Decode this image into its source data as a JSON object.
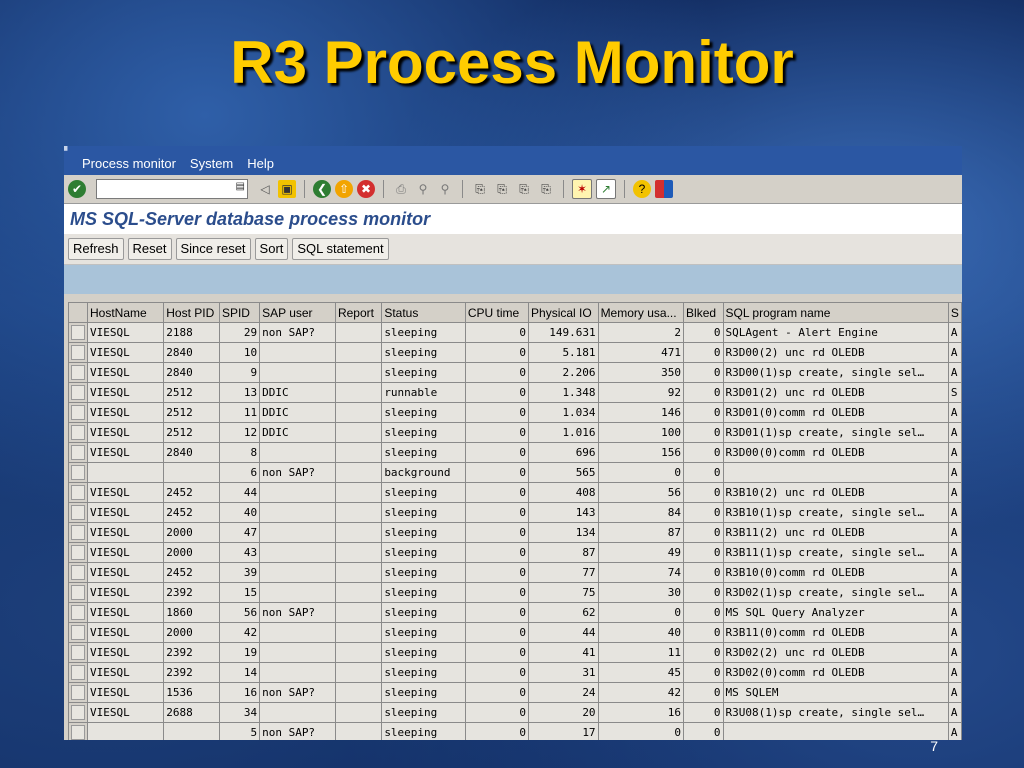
{
  "slide": {
    "title": "R3 Process Monitor",
    "page_number": "7"
  },
  "menu": {
    "items": [
      "Process monitor",
      "System",
      "Help"
    ]
  },
  "screen": {
    "title": "MS SQL-Server database process monitor"
  },
  "buttons": [
    "Refresh",
    "Reset",
    "Since reset",
    "Sort",
    "SQL statement"
  ],
  "columns": [
    "HostName",
    "Host PID",
    "SPID",
    "SAP user",
    "Report",
    "Status",
    "CPU time",
    "Physical IO",
    "Memory usa...",
    "Blked",
    "SQL program name",
    "S"
  ],
  "rows": [
    [
      "VIESQL",
      "2188",
      "29",
      "non SAP?",
      "",
      "sleeping",
      "0",
      "149.631",
      "2",
      "0",
      "SQLAgent - Alert Engine",
      "A"
    ],
    [
      "VIESQL",
      "2840",
      "10",
      "",
      "",
      "sleeping",
      "0",
      "5.181",
      "471",
      "0",
      "R3D00(2) unc rd OLEDB",
      "A"
    ],
    [
      "VIESQL",
      "2840",
      "9",
      "",
      "",
      "sleeping",
      "0",
      "2.206",
      "350",
      "0",
      "R3D00(1)sp create, single sel…",
      "A"
    ],
    [
      "VIESQL",
      "2512",
      "13",
      "DDIC",
      "",
      "runnable",
      "0",
      "1.348",
      "92",
      "0",
      "R3D01(2) unc rd OLEDB",
      "S"
    ],
    [
      "VIESQL",
      "2512",
      "11",
      "DDIC",
      "",
      "sleeping",
      "0",
      "1.034",
      "146",
      "0",
      "R3D01(0)comm rd OLEDB",
      "A"
    ],
    [
      "VIESQL",
      "2512",
      "12",
      "DDIC",
      "",
      "sleeping",
      "0",
      "1.016",
      "100",
      "0",
      "R3D01(1)sp create, single sel…",
      "A"
    ],
    [
      "VIESQL",
      "2840",
      "8",
      "",
      "",
      "sleeping",
      "0",
      "696",
      "156",
      "0",
      "R3D00(0)comm rd OLEDB",
      "A"
    ],
    [
      "",
      "",
      "6",
      "non SAP?",
      "",
      "background",
      "0",
      "565",
      "0",
      "0",
      "",
      "A"
    ],
    [
      "VIESQL",
      "2452",
      "44",
      "",
      "",
      "sleeping",
      "0",
      "408",
      "56",
      "0",
      "R3B10(2) unc rd OLEDB",
      "A"
    ],
    [
      "VIESQL",
      "2452",
      "40",
      "",
      "",
      "sleeping",
      "0",
      "143",
      "84",
      "0",
      "R3B10(1)sp create, single sel…",
      "A"
    ],
    [
      "VIESQL",
      "2000",
      "47",
      "",
      "",
      "sleeping",
      "0",
      "134",
      "87",
      "0",
      "R3B11(2) unc rd OLEDB",
      "A"
    ],
    [
      "VIESQL",
      "2000",
      "43",
      "",
      "",
      "sleeping",
      "0",
      "87",
      "49",
      "0",
      "R3B11(1)sp create, single sel…",
      "A"
    ],
    [
      "VIESQL",
      "2452",
      "39",
      "",
      "",
      "sleeping",
      "0",
      "77",
      "74",
      "0",
      "R3B10(0)comm rd OLEDB",
      "A"
    ],
    [
      "VIESQL",
      "2392",
      "15",
      "",
      "",
      "sleeping",
      "0",
      "75",
      "30",
      "0",
      "R3D02(1)sp create, single sel…",
      "A"
    ],
    [
      "VIESQL",
      "1860",
      "56",
      "non SAP?",
      "",
      "sleeping",
      "0",
      "62",
      "0",
      "0",
      "MS SQL Query Analyzer",
      "A"
    ],
    [
      "VIESQL",
      "2000",
      "42",
      "",
      "",
      "sleeping",
      "0",
      "44",
      "40",
      "0",
      "R3B11(0)comm rd OLEDB",
      "A"
    ],
    [
      "VIESQL",
      "2392",
      "19",
      "",
      "",
      "sleeping",
      "0",
      "41",
      "11",
      "0",
      "R3D02(2) unc rd OLEDB",
      "A"
    ],
    [
      "VIESQL",
      "2392",
      "14",
      "",
      "",
      "sleeping",
      "0",
      "31",
      "45",
      "0",
      "R3D02(0)comm rd OLEDB",
      "A"
    ],
    [
      "VIESQL",
      "1536",
      "16",
      "non SAP?",
      "",
      "sleeping",
      "0",
      "24",
      "42",
      "0",
      "MS SQLEM",
      "A"
    ],
    [
      "VIESQL",
      "2688",
      "34",
      "",
      "",
      "sleeping",
      "0",
      "20",
      "16",
      "0",
      "R3U08(1)sp create, single sel…",
      "A"
    ],
    [
      "",
      "",
      "5",
      "non SAP?",
      "",
      "sleeping",
      "0",
      "17",
      "0",
      "0",
      "",
      "A"
    ]
  ],
  "toolbar_icons": [
    "enter-icon",
    "back-icon",
    "save-icon",
    "back-green-icon",
    "exit-icon",
    "cancel-icon",
    "print-icon",
    "find-icon",
    "find-next-icon",
    "first-page-icon",
    "prev-page-icon",
    "next-page-icon",
    "last-page-icon",
    "new-session-icon",
    "shortcut-icon",
    "help-icon",
    "layout-icon"
  ]
}
